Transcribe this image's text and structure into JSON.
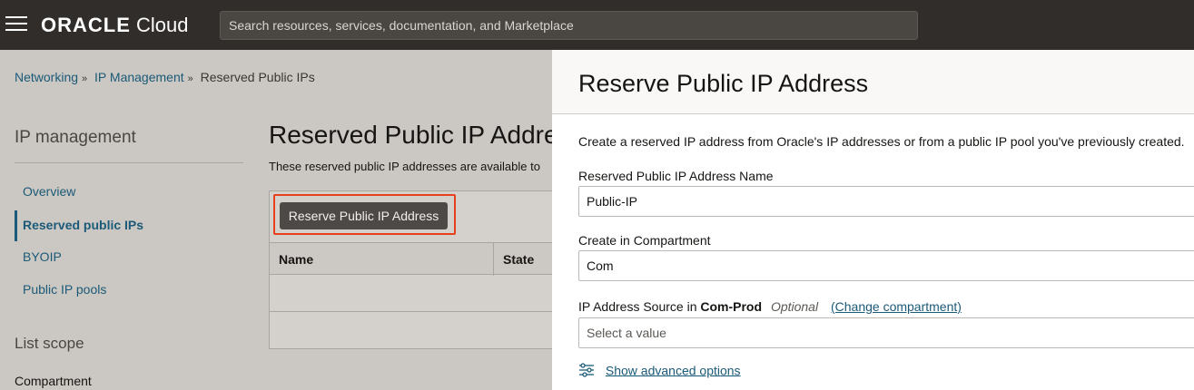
{
  "topbar": {
    "brand_oracle": "ORACLE",
    "brand_cloud": "Cloud",
    "search_placeholder": "Search resources, services, documentation, and Marketplace"
  },
  "breadcrumb": {
    "items": [
      "Networking",
      "IP Management",
      "Reserved Public IPs"
    ],
    "separator": "»"
  },
  "sidebar": {
    "title": "IP management",
    "items": [
      {
        "label": "Overview",
        "active": false
      },
      {
        "label": "Reserved public IPs",
        "active": true
      },
      {
        "label": "BYOIP",
        "active": false
      },
      {
        "label": "Public IP pools",
        "active": false
      }
    ],
    "list_scope": "List scope",
    "compartment_label": "Compartment"
  },
  "main": {
    "title": "Reserved Public IP Addresses",
    "description": "These reserved public IP addresses are available to",
    "reserve_button": "Reserve Public IP Address",
    "columns": [
      "Name",
      "State"
    ]
  },
  "panel": {
    "title": "Reserve Public IP Address",
    "intro": "Create a reserved IP address from Oracle's IP addresses or from a public IP pool you've previously created.",
    "name_label": "Reserved Public IP Address Name",
    "name_value": "Public-IP",
    "compartment_label": "Create in Compartment",
    "compartment_value": "Com",
    "source_label_prefix": "IP Address Source in",
    "source_compartment": "Com-Prod",
    "source_optional": "Optional",
    "change_compartment": "(Change compartment)",
    "source_placeholder": "Select a value",
    "advanced": "Show advanced options"
  },
  "colors": {
    "topbar": "#312d2a",
    "link": "#1b5a78",
    "highlight": "#e8401f"
  }
}
